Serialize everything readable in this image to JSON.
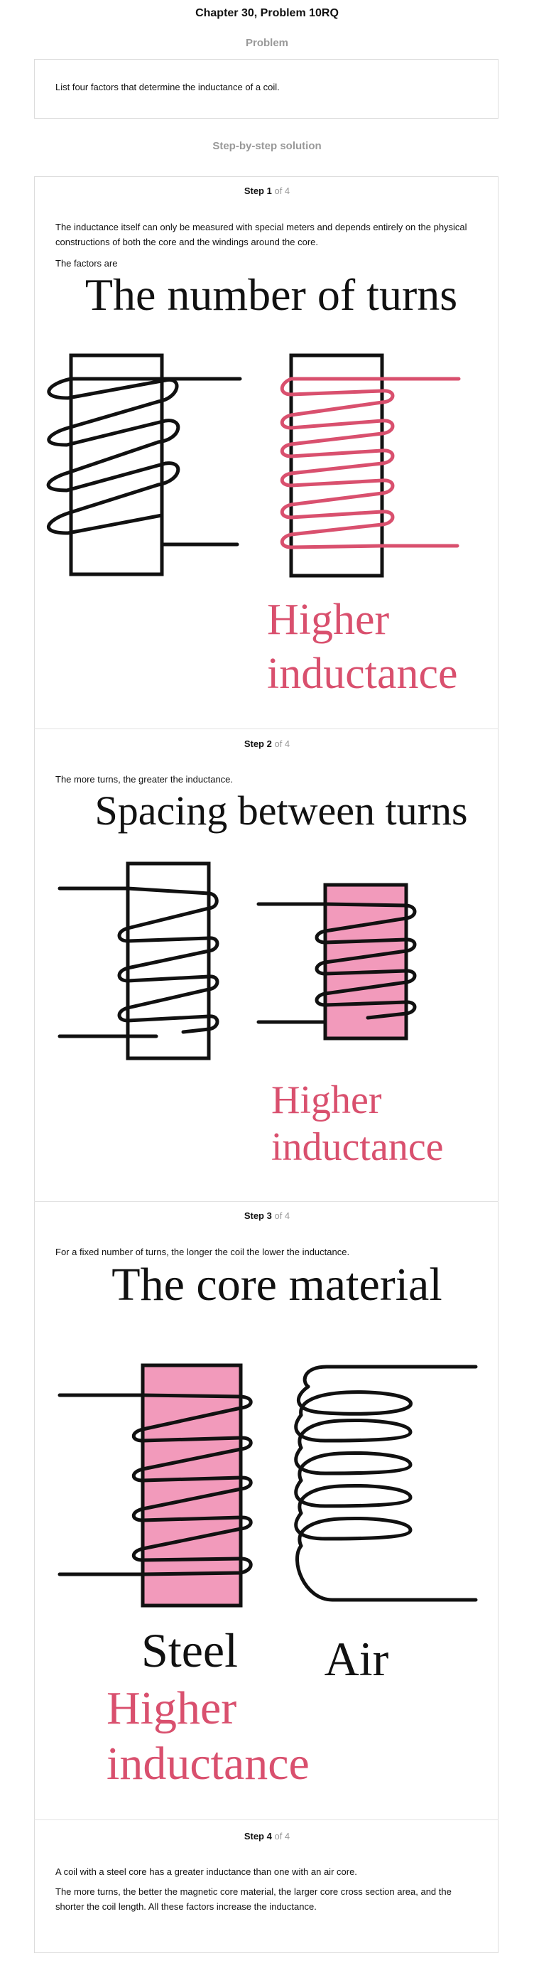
{
  "header": {
    "title": "Chapter 30, Problem 10RQ"
  },
  "problem": {
    "label": "Problem",
    "text": "List four factors that determine the inductance of a coil."
  },
  "solution": {
    "label": "Step-by-step solution"
  },
  "steps": [
    {
      "num": "Step 1",
      "of": "of 4",
      "paragraphs": [
        "The inductance itself can only be measured with special meters and depends entirely on the physical constructions of both the core and the windings around the core.",
        "The factors are"
      ],
      "figure": {
        "heading": "The number of turns",
        "caption_line1": "Higher",
        "caption_line2": "inductance"
      }
    },
    {
      "num": "Step 2",
      "of": "of 4",
      "paragraphs": [
        "The more turns, the greater the inductance."
      ],
      "figure": {
        "heading": "Spacing between turns",
        "caption_line1": "Higher",
        "caption_line2": "inductance"
      }
    },
    {
      "num": "Step 3",
      "of": "of 4",
      "paragraphs": [
        "For a fixed number of turns, the longer the coil the lower the inductance."
      ],
      "figure": {
        "heading": "The core material",
        "left_label": "Steel",
        "right_label": "Air",
        "caption_line1": "Higher",
        "caption_line2": "inductance"
      }
    },
    {
      "num": "Step 4",
      "of": "of 4",
      "paragraphs": [
        "A coil with a steel core has a greater inductance than one with an air core.",
        "The more turns, the better the magnetic core material, the larger core cross section area, and the shorter the coil length. All these factors increase the inductance."
      ]
    }
  ],
  "colors": {
    "accent": "#d9506e",
    "core_fill": "#f29abb",
    "ink": "#111111",
    "muted": "#999999"
  }
}
